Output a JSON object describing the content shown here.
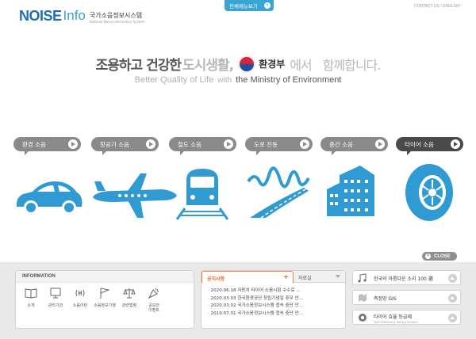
{
  "header": {
    "logo_noise": "NOISE",
    "logo_info": "Info",
    "logo_kr": "국가소음정보시스템",
    "logo_en": "National Noise Information System",
    "all_menu": "전체메뉴보기",
    "top_links": "CONTACT US / ENGLISH"
  },
  "hero": {
    "line1_a": "조용하고 건강한",
    "line1_b": "도시생활,",
    "ministry_kr": "환경부",
    "line1_c": "에서",
    "line1_d": "함께합니다.",
    "line2_a": "Better Quality of Life",
    "line2_b": "with",
    "line2_c": "the Ministry of Environment"
  },
  "categories": [
    {
      "label": "환경 소음",
      "icon": "car-icon"
    },
    {
      "label": "항공기 소음",
      "icon": "airplane-icon"
    },
    {
      "label": "철도 소음",
      "icon": "train-icon"
    },
    {
      "label": "도로 진동",
      "icon": "road-vibration-icon"
    },
    {
      "label": "층간 소음",
      "icon": "apartment-icon"
    },
    {
      "label": "타이어 소음",
      "icon": "tire-icon"
    }
  ],
  "close_label": "CLOSE",
  "information": {
    "title": "INFORMATION",
    "items": [
      {
        "label": "소개",
        "icon": "book-icon"
      },
      {
        "label": "관리기관",
        "icon": "monitor-icon"
      },
      {
        "label": "소음이란",
        "icon": "sound-wave-icon"
      },
      {
        "label": "소음정보기행",
        "icon": "flag-icon"
      },
      {
        "label": "관련법령",
        "icon": "scales-icon"
      },
      {
        "label": "공모전\n이벤트",
        "icon": "party-icon"
      }
    ]
  },
  "news": {
    "tab_notice": "공지사항",
    "tab_data": "자료실",
    "items": [
      "· 2020.06.18 자동차 타이어 소음시험 수수료 ...",
      "· 2020.03.03 한국환경공단 창립기념일 휴무 안...",
      "· 2020.03.02 국가소음정보시스템 접속 중단 안...",
      "· 2019.07.31 국가소음정보시스템 접속 중단 안..."
    ]
  },
  "side": [
    {
      "label": "한국의 아름다운 소리 100 選",
      "sub": "",
      "icon": "music-note-icon"
    },
    {
      "label": "측정망 GIS",
      "sub": "",
      "icon": "map-icon"
    },
    {
      "label": "타이어 효율 등급제",
      "sub": "Tyre Efficiency Rating System",
      "icon": "tire-grade-icon"
    }
  ],
  "colors": {
    "brand_blue": "#3aa5d4",
    "icon_blue": "#2f9bd2",
    "notice_orange": "#e36a2c"
  }
}
